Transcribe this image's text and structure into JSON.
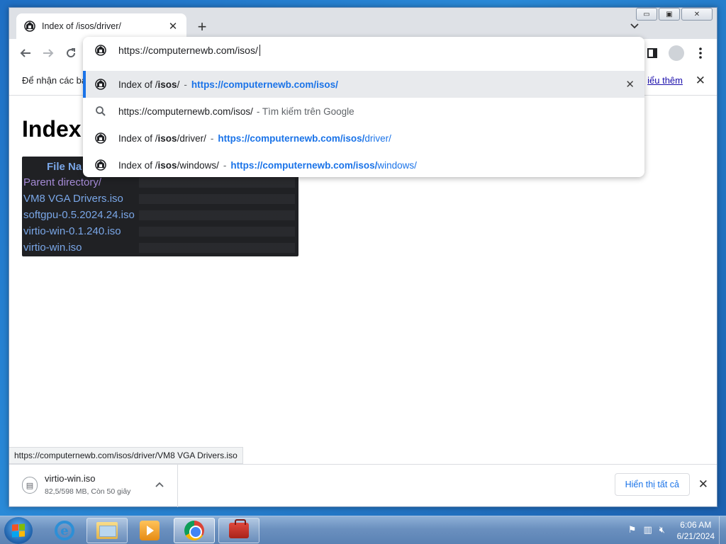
{
  "tab": {
    "title": "Index of /isos/driver/",
    "close": "✕"
  },
  "newtab": "+",
  "window_controls": {
    "min": "▭",
    "max": "▣",
    "close": "✕"
  },
  "omnibox": {
    "value": "https://computernewb.com/isos/",
    "suggestions": [
      {
        "title_pre": "Index of /",
        "title_bold": "isos",
        "title_post": "/",
        "sep": "-",
        "url_bold": "https://computernewb.com/isos/",
        "url_rest": "",
        "selected": true,
        "icon": "site-icon",
        "remove": "✕"
      },
      {
        "query": "https://computernewb.com/isos/",
        "dim": "- Tìm kiếm trên Google",
        "icon": "search-icon"
      },
      {
        "title_pre": "Index of /",
        "title_bold": "isos",
        "title_post": "/driver/",
        "sep": "-",
        "url_bold": "https://computernewb.com/isos/",
        "url_rest": "driver/",
        "icon": "site-icon"
      },
      {
        "title_pre": "Index of /",
        "title_bold": "isos",
        "title_post": "/windows/",
        "sep": "-",
        "url_bold": "https://computernewb.com/isos/",
        "url_rest": "windows/",
        "icon": "site-icon"
      }
    ]
  },
  "infobar": {
    "text": "Để nhận các bả",
    "learn_more": "iểu thêm",
    "close": "✕"
  },
  "page": {
    "heading": "Index",
    "table_header": "File Na",
    "files": [
      {
        "name": "Parent directory/",
        "type": "parent"
      },
      {
        "name": "VM8 VGA Drivers.iso",
        "type": "file"
      },
      {
        "name": "softgpu-0.5.2024.24.iso",
        "type": "file"
      },
      {
        "name": "virtio-win-0.1.240.iso",
        "type": "file"
      },
      {
        "name": "virtio-win.iso",
        "type": "file"
      }
    ]
  },
  "status_url": "https://computernewb.com/isos/driver/VM8 VGA Drivers.iso",
  "download": {
    "name": "virtio-win.iso",
    "meta": "82,5/598 MB, Còn 50 giây",
    "show_all": "Hiển thị tất cả",
    "close": "✕"
  },
  "taskbar": {
    "time": "6:06 AM",
    "date": "6/21/2024"
  },
  "colors": {
    "accent": "#1a73e8",
    "link_dark": "#7aa7e8",
    "visited": "#a58ad6",
    "table_bg": "#202124"
  }
}
